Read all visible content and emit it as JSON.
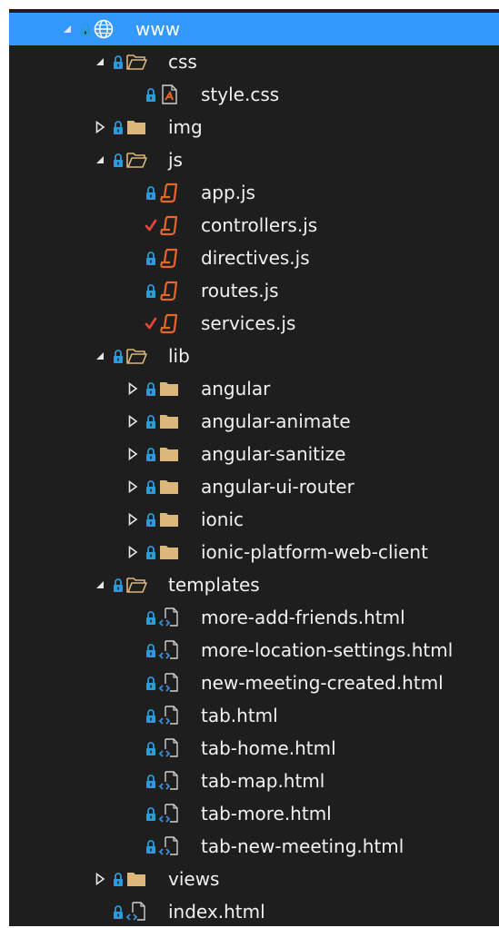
{
  "colors": {
    "panel_bg": "#1e1e1e",
    "selection_bg": "#3399ff",
    "text": "#f1f1f1",
    "lock_blue": "#2b9bd9",
    "check_red": "#e8463d",
    "folder_gold": "#dcb67a",
    "js_orange": "#e8662a",
    "css_orange": "#e8662a",
    "html_blue": "#3f8fd8"
  },
  "tree": {
    "items": [
      {
        "label": "www",
        "depth": 0,
        "expander": "expanded",
        "icon": "globe-icon",
        "state": "lock",
        "selected": true
      },
      {
        "label": "css",
        "depth": 1,
        "expander": "expanded",
        "icon": "folder-open-icon",
        "state": "lock"
      },
      {
        "label": "style.css",
        "depth": 2,
        "expander": "none",
        "icon": "css-file-icon",
        "state": "lock"
      },
      {
        "label": "img",
        "depth": 1,
        "expander": "collapsed",
        "icon": "folder-icon",
        "state": "lock"
      },
      {
        "label": "js",
        "depth": 1,
        "expander": "expanded",
        "icon": "folder-open-icon",
        "state": "lock"
      },
      {
        "label": "app.js",
        "depth": 2,
        "expander": "none",
        "icon": "js-file-icon",
        "state": "lock"
      },
      {
        "label": "controllers.js",
        "depth": 2,
        "expander": "none",
        "icon": "js-file-icon",
        "state": "checkout"
      },
      {
        "label": "directives.js",
        "depth": 2,
        "expander": "none",
        "icon": "js-file-icon",
        "state": "lock"
      },
      {
        "label": "routes.js",
        "depth": 2,
        "expander": "none",
        "icon": "js-file-icon",
        "state": "lock"
      },
      {
        "label": "services.js",
        "depth": 2,
        "expander": "none",
        "icon": "js-file-icon",
        "state": "checkout"
      },
      {
        "label": "lib",
        "depth": 1,
        "expander": "expanded",
        "icon": "folder-open-icon",
        "state": "lock"
      },
      {
        "label": "angular",
        "depth": 2,
        "expander": "collapsed",
        "icon": "folder-icon",
        "state": "lock"
      },
      {
        "label": "angular-animate",
        "depth": 2,
        "expander": "collapsed",
        "icon": "folder-icon",
        "state": "lock"
      },
      {
        "label": "angular-sanitize",
        "depth": 2,
        "expander": "collapsed",
        "icon": "folder-icon",
        "state": "lock"
      },
      {
        "label": "angular-ui-router",
        "depth": 2,
        "expander": "collapsed",
        "icon": "folder-icon",
        "state": "lock"
      },
      {
        "label": "ionic",
        "depth": 2,
        "expander": "collapsed",
        "icon": "folder-icon",
        "state": "lock"
      },
      {
        "label": "ionic-platform-web-client",
        "depth": 2,
        "expander": "collapsed",
        "icon": "folder-icon",
        "state": "lock"
      },
      {
        "label": "templates",
        "depth": 1,
        "expander": "expanded",
        "icon": "folder-open-icon",
        "state": "lock"
      },
      {
        "label": "more-add-friends.html",
        "depth": 2,
        "expander": "none",
        "icon": "html-file-icon",
        "state": "lock"
      },
      {
        "label": "more-location-settings.html",
        "depth": 2,
        "expander": "none",
        "icon": "html-file-icon",
        "state": "lock"
      },
      {
        "label": "new-meeting-created.html",
        "depth": 2,
        "expander": "none",
        "icon": "html-file-icon",
        "state": "lock"
      },
      {
        "label": "tab.html",
        "depth": 2,
        "expander": "none",
        "icon": "html-file-icon",
        "state": "lock"
      },
      {
        "label": "tab-home.html",
        "depth": 2,
        "expander": "none",
        "icon": "html-file-icon",
        "state": "lock"
      },
      {
        "label": "tab-map.html",
        "depth": 2,
        "expander": "none",
        "icon": "html-file-icon",
        "state": "lock"
      },
      {
        "label": "tab-more.html",
        "depth": 2,
        "expander": "none",
        "icon": "html-file-icon",
        "state": "lock"
      },
      {
        "label": "tab-new-meeting.html",
        "depth": 2,
        "expander": "none",
        "icon": "html-file-icon",
        "state": "lock"
      },
      {
        "label": "views",
        "depth": 1,
        "expander": "collapsed",
        "icon": "folder-icon",
        "state": "lock"
      },
      {
        "label": "index.html",
        "depth": 1,
        "expander": "none",
        "icon": "html-file-icon",
        "state": "lock"
      }
    ]
  }
}
